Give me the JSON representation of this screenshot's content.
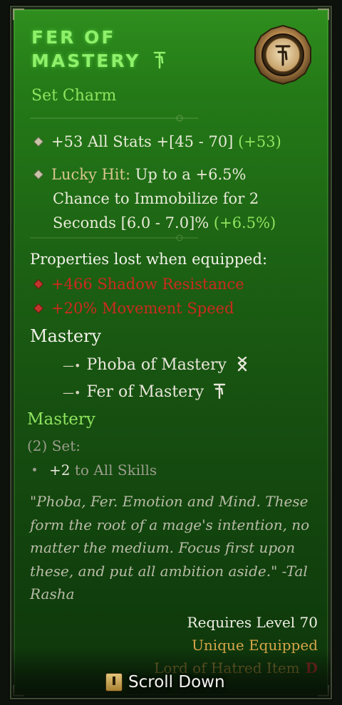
{
  "item": {
    "title_line1": "Fer of",
    "title_line2": "Mastery",
    "subtitle": "Set Charm"
  },
  "stats": [
    {
      "text": "+53 All Stats +[45 - 70] ",
      "bonus": "(+53)"
    },
    {
      "label": "Lucky Hit:",
      "line1": " Up to a +6.5%",
      "line2": "Chance to Immobilize for 2",
      "line3": "Seconds [6.0 - 7.0]% ",
      "bonus": "(+6.5%)"
    }
  ],
  "lost": {
    "heading": "Properties lost when equipped:",
    "items": [
      "+466 Shadow Resistance",
      "+20% Movement Speed"
    ]
  },
  "mastery": {
    "heading": "Mastery",
    "pieces": [
      "Phoba of Mastery",
      "Fer of Mastery"
    ]
  },
  "set": {
    "name": "Mastery",
    "count": "(2) Set:",
    "bonus_value": "+2",
    "bonus_text": " to All Skills"
  },
  "flavor": "\"Phoba, Fer. Emotion and Mind. These form the root of a mage's intention, no matter the medium. Focus first upon these, and put all ambition aside.\" -Tal Rasha",
  "requirements": {
    "level": "Requires Level 70",
    "unique": "Unique Equipped",
    "hatred": "Lord of Hatred Item"
  },
  "hint": {
    "label": "Scroll Down",
    "key_icon": "key-icon"
  },
  "colors": {
    "set_green": "#8fe35f",
    "title_green": "#8ff06a",
    "lost_red": "#cc2a1e",
    "unique_gold": "#d8a64a"
  }
}
